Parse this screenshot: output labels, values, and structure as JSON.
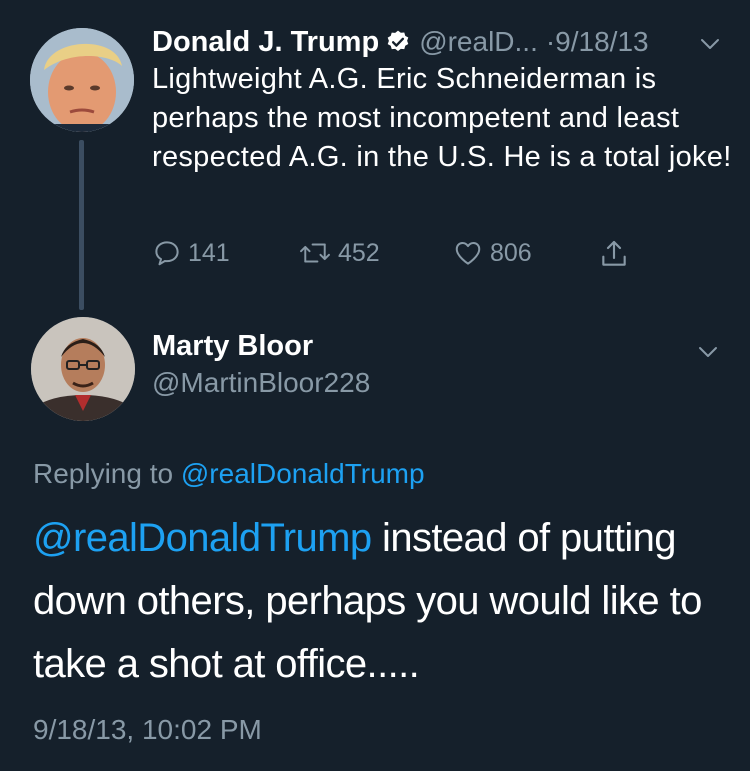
{
  "original_tweet": {
    "author_name": "Donald J. Trump",
    "author_handle": "@realD...",
    "date": "·9/18/13",
    "text": "Lightweight A.G. Eric Schneiderman is perhaps the most incompetent and least respected A.G. in the U.S. He is a total joke!",
    "replies": "141",
    "retweets": "452",
    "likes": "806"
  },
  "reply_tweet": {
    "author_name": "Marty Bloor",
    "author_handle": "@MartinBloor228",
    "replying_to_prefix": "Replying to ",
    "replying_to_handle": "@realDonaldTrump",
    "mention": "@realDonaldTrump",
    "text": " instead of putting down others, perhaps you would like to take a shot at office.....",
    "timestamp": "9/18/13, 10:02 PM"
  },
  "colors": {
    "background": "#15202b",
    "secondary_text": "#8899a6",
    "link": "#1da1f2",
    "verified_badge": "#ffffff"
  },
  "icons": [
    "verified-badge-icon",
    "chevron-down-icon",
    "reply-icon",
    "retweet-icon",
    "like-icon",
    "share-icon"
  ]
}
